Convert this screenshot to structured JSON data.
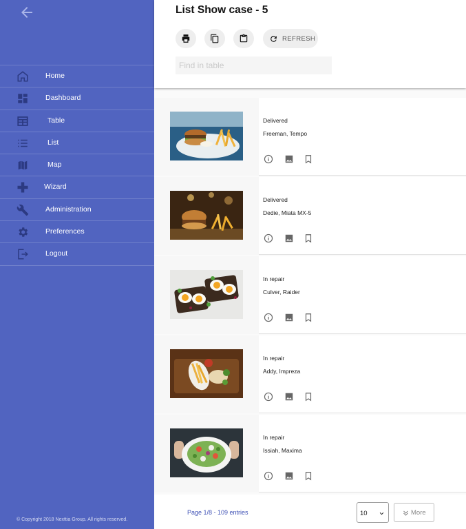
{
  "sidebar": {
    "items": [
      {
        "label": "Home",
        "icon": "home-icon"
      },
      {
        "label": "Dashboard",
        "icon": "dashboard-icon"
      },
      {
        "label": "Table",
        "icon": "table-icon"
      },
      {
        "label": "List",
        "icon": "list-icon"
      },
      {
        "label": "Map",
        "icon": "map-icon"
      },
      {
        "label": "Wizard",
        "icon": "plus-icon"
      },
      {
        "label": "Administration",
        "icon": "wrench-icon"
      },
      {
        "label": "Preferences",
        "icon": "gear-icon"
      },
      {
        "label": "Logout",
        "icon": "logout-icon"
      }
    ],
    "copyright": "© Copyright 2018 Nexttia Group. All rights reserved."
  },
  "header": {
    "title": "List Show case - 5",
    "refresh_label": "REFRESH",
    "search_placeholder": "Find in table",
    "tool_icons": [
      "print-icon",
      "copy-icon",
      "clipboard-icon",
      "refresh-icon"
    ]
  },
  "list": {
    "rows": [
      {
        "status": "Delivered",
        "customer": "Freeman, Tempo",
        "image": "burger-fries-photo"
      },
      {
        "status": "Delivered",
        "customer": "Dedie, Miata MX-5",
        "image": "burger-dark-photo"
      },
      {
        "status": "In repair",
        "customer": "Culver, Raider",
        "image": "egg-toast-photo"
      },
      {
        "status": "In repair",
        "customer": "Addy, Impreza",
        "image": "fries-board-photo"
      },
      {
        "status": "In repair",
        "customer": "Issiah, Maxima",
        "image": "salad-bowl-photo"
      }
    ],
    "row_action_icons": [
      "info-icon",
      "image-icon",
      "bookmark-icon"
    ]
  },
  "footer": {
    "page_info": "Page 1/8 - 109 entries",
    "page_size": "10",
    "more_label": "More"
  },
  "colors": {
    "sidebar": "#5164c0",
    "accent": "#3f51b5"
  }
}
